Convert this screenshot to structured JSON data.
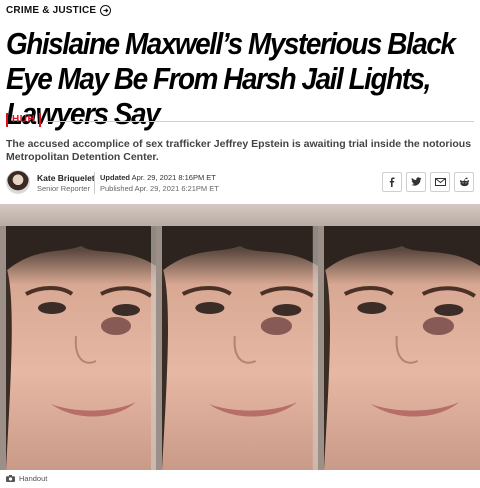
{
  "section": {
    "label": "CRIME & JUSTICE",
    "icon": "arrow-right-circle-icon"
  },
  "headline": "Ghislaine Maxwell’s Mysterious Black Eye May Be From Harsh Jail Lights, Lawyers Say",
  "tag": "HUH",
  "dek": "The accused accomplice of sex trafficker Jeffrey Epstein is awaiting trial inside the notorious Metropolitan Detention Center.",
  "author": {
    "name": "Kate Briquelet",
    "title": "Senior Reporter"
  },
  "dates": {
    "updated_label": "Updated",
    "updated": "Apr. 29, 2021 8:16PM ET",
    "published_label": "Published",
    "published": "Apr. 29, 2021 6:21PM ET"
  },
  "share": [
    {
      "icon": "facebook-icon"
    },
    {
      "icon": "twitter-icon"
    },
    {
      "icon": "email-icon"
    },
    {
      "icon": "reddit-icon"
    }
  ],
  "image": {
    "caption": "Handout",
    "caption_icon": "camera-icon"
  },
  "colors": {
    "accent": "#e0101e",
    "text": "#111111",
    "muted": "#444444"
  }
}
